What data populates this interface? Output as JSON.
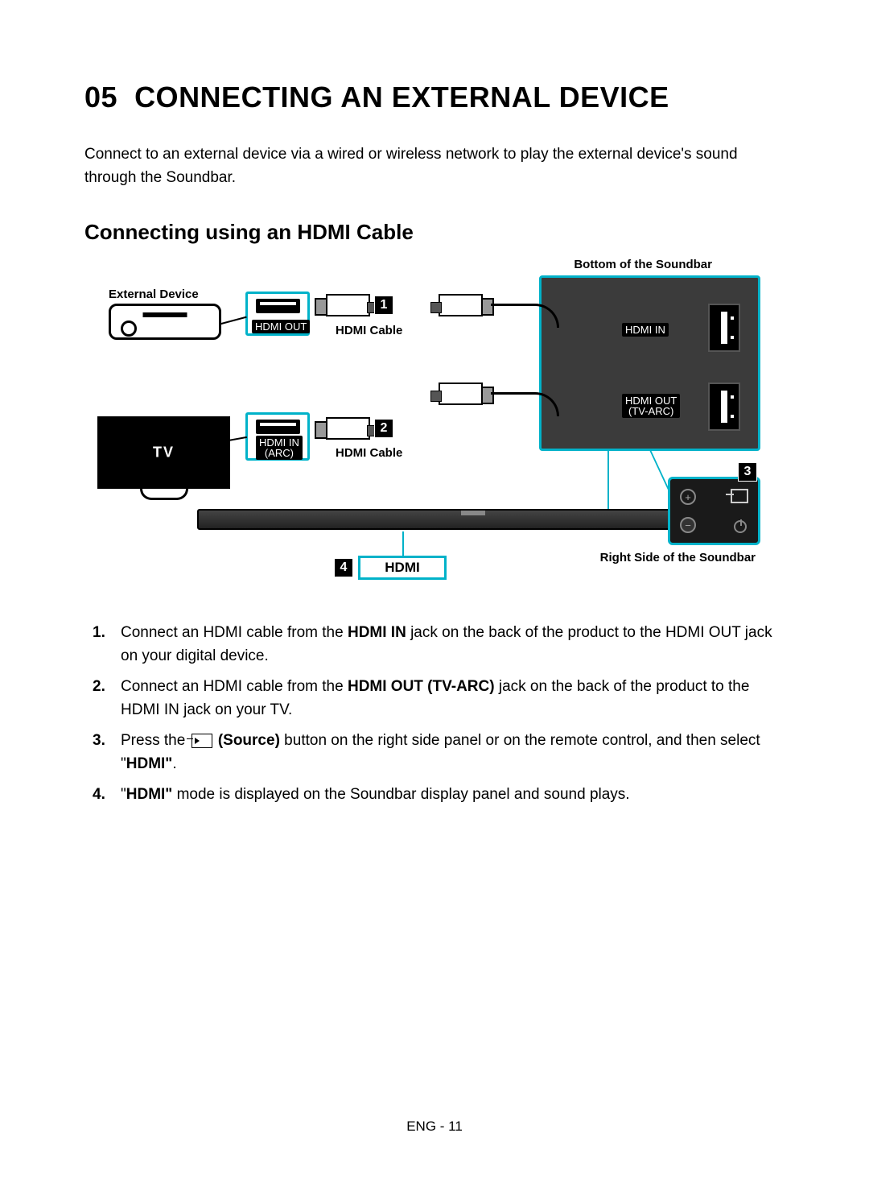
{
  "chapter": {
    "num": "05",
    "title": "CONNECTING AN EXTERNAL DEVICE"
  },
  "intro": "Connect to an external device via a wired or wireless network to play the external device's sound through the Soundbar.",
  "section_title": "Connecting using an HDMI Cable",
  "diagram": {
    "external_device_label": "External Device",
    "bottom_label": "Bottom of the Soundbar",
    "right_label": "Right Side of the Soundbar",
    "hdmi_out": "HDMI OUT",
    "hdmi_in_arc": "HDMI IN\n(ARC)",
    "hdmi_cable": "HDMI Cable",
    "tv": "TV",
    "hdmi_in": "HDMI IN",
    "hdmi_out_tvarc": "HDMI OUT\n(TV-ARC)",
    "hdmi_display": "HDMI",
    "markers": {
      "m1": "1",
      "m2": "2",
      "m3": "3",
      "m4": "4"
    }
  },
  "steps": [
    {
      "pre": "Connect an HDMI cable from the ",
      "b1": "HDMI IN",
      "mid": " jack on the back of the product to the HDMI OUT jack on your digital device."
    },
    {
      "pre": "Connect an HDMI cable from the ",
      "b1": "HDMI OUT (TV-ARC)",
      "mid": " jack on the back of the product to the HDMI IN jack on your TV."
    },
    {
      "pre": "Press the ",
      "source": "(Source)",
      "mid": " button on the right side panel or on the remote control, and then select \"",
      "b1": "HDMI\"",
      "post": "."
    },
    {
      "pre": "\"",
      "b1": "HDMI\"",
      "mid": " mode is displayed on the Soundbar display panel and sound plays."
    }
  ],
  "footer": "ENG - 11"
}
